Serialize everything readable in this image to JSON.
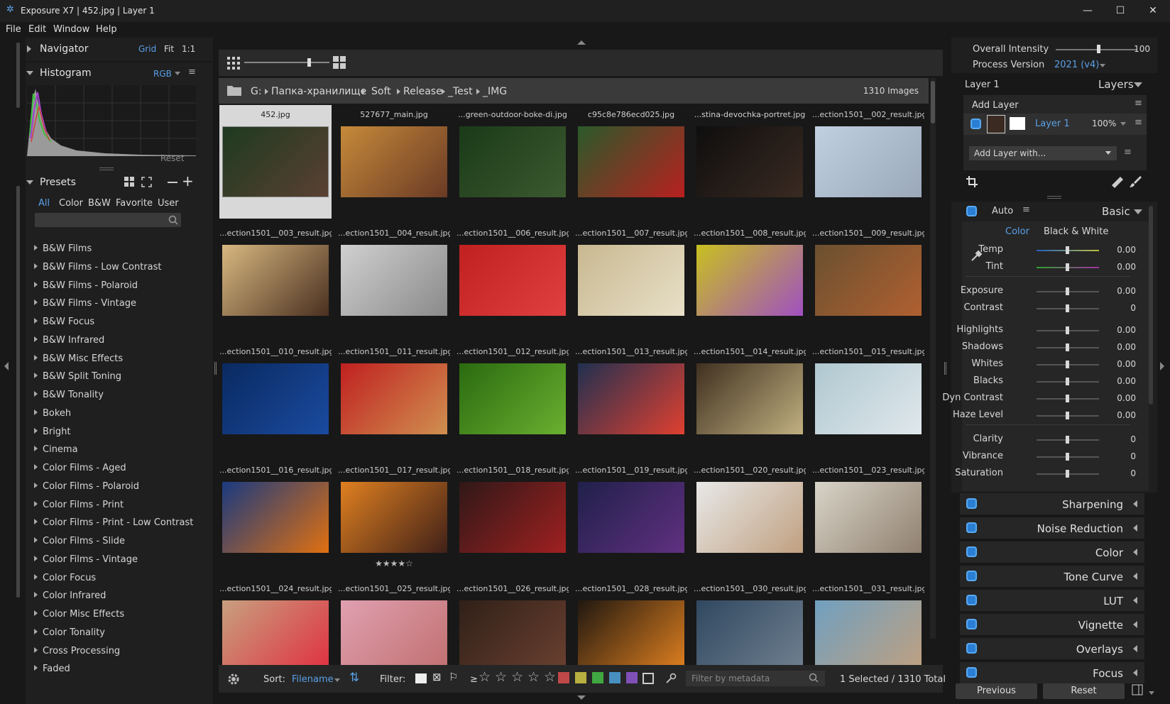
{
  "window": {
    "title": "Exposure X7 | 452.jpg | Layer 1",
    "app_icon": "exposure-logo-icon"
  },
  "menu": [
    "File",
    "Edit",
    "Window",
    "Help"
  ],
  "navigator": {
    "title": "Navigator",
    "options": [
      "Grid",
      "Fit",
      "1:1"
    ],
    "active": "Grid"
  },
  "histogram": {
    "title": "Histogram",
    "channel": "RGB",
    "reset": "Reset"
  },
  "presets": {
    "title": "Presets",
    "tabs": [
      "All",
      "Color",
      "B&W",
      "Favorite",
      "User"
    ],
    "active_tab": "All",
    "search_placeholder": "",
    "items": [
      "B&W Films",
      "B&W Films - Low Contrast",
      "B&W Films - Polaroid",
      "B&W Films - Vintage",
      "B&W Focus",
      "B&W Infrared",
      "B&W Misc Effects",
      "B&W Split Toning",
      "B&W Tonality",
      "Bokeh",
      "Bright",
      "Cinema",
      "Color Films - Aged",
      "Color Films - Polaroid",
      "Color Films - Print",
      "Color Films - Print - Low Contrast",
      "Color Films - Slide",
      "Color Films - Vintage",
      "Color Focus",
      "Color Infrared",
      "Color Misc Effects",
      "Color Tonality",
      "Cross Processing",
      "Faded"
    ]
  },
  "breadcrumb": {
    "drive": "G:",
    "path": [
      "Папка-хранилище",
      "Soft",
      "Release",
      "_Test",
      "_IMG"
    ],
    "count": "1310 Images"
  },
  "grid": {
    "selected_index": 0,
    "rated_index": 19,
    "rating": "★★★★☆",
    "captions": [
      "452.jpg",
      "527677_main.jpg",
      "...green-outdoor-boke-di.jpg",
      "c95c8e786ecd025.jpg",
      "...stina-devochka-portret.jpg",
      "...ection1501__002_result.jpg",
      "...ection1501__003_result.jpg",
      "...ection1501__004_result.jpg",
      "...ection1501__006_result.jpg",
      "...ection1501__007_result.jpg",
      "...ection1501__008_result.jpg",
      "...ection1501__009_result.jpg",
      "...ection1501__010_result.jpg",
      "...ection1501__011_result.jpg",
      "...ection1501__012_result.jpg",
      "...ection1501__013_result.jpg",
      "...ection1501__014_result.jpg",
      "...ection1501__015_result.jpg",
      "...ection1501__016_result.jpg",
      "...ection1501__017_result.jpg",
      "...ection1501__018_result.jpg",
      "...ection1501__019_result.jpg",
      "...ection1501__020_result.jpg",
      "...ection1501__023_result.jpg",
      "...ection1501__024_result.jpg",
      "...ection1501__025_result.jpg",
      "...ection1501__026_result.jpg",
      "...ection1501__028_result.jpg",
      "...ection1501__030_result.jpg",
      "...ection1501__031_result.jpg"
    ],
    "colors": [
      [
        "#1e3a20",
        "#5a4032"
      ],
      [
        "#c68a3a",
        "#6a3a25"
      ],
      [
        "#1a3a18",
        "#3c5a30"
      ],
      [
        "#2a5a2a",
        "#b82020"
      ],
      [
        "#0e0e0e",
        "#3a2a22"
      ],
      [
        "#c0d0e0",
        "#9aa8b8"
      ],
      [
        "#d8b880",
        "#4a3020"
      ],
      [
        "#d0d0d0",
        "#8a8a8a"
      ],
      [
        "#c02020",
        "#e04040"
      ],
      [
        "#c8b890",
        "#e8e0c8"
      ],
      [
        "#c8c020",
        "#a050c0"
      ],
      [
        "#6a5030",
        "#b06030"
      ],
      [
        "#0a2a60",
        "#1a4aa0"
      ],
      [
        "#c02020",
        "#d09050"
      ],
      [
        "#2a6a10",
        "#6ab030"
      ],
      [
        "#203050",
        "#e04030"
      ],
      [
        "#403020",
        "#c0b080"
      ],
      [
        "#b0c8d0",
        "#e0e8ec"
      ],
      [
        "#1a3a80",
        "#e07010"
      ],
      [
        "#e08020",
        "#402018"
      ],
      [
        "#301818",
        "#a02020"
      ],
      [
        "#20204a",
        "#603080"
      ],
      [
        "#e8e8e8",
        "#c0a080"
      ],
      [
        "#d8d4c8",
        "#908070"
      ],
      [
        "#c8a080",
        "#e03040"
      ],
      [
        "#e0a0b0",
        "#c07070"
      ],
      [
        "#302018",
        "#6a4030"
      ],
      [
        "#201810",
        "#e08020"
      ],
      [
        "#304860",
        "#708090"
      ],
      [
        "#70a0c0",
        "#c0a080"
      ]
    ]
  },
  "right": {
    "overall_intensity": {
      "label": "Overall Intensity",
      "value": "100",
      "level": 1.0
    },
    "process_version": {
      "label": "Process Version",
      "value": "2021 (v4)"
    },
    "layer_name": "Layer 1",
    "layers_label": "Layers",
    "add_layer": "Add Layer",
    "layer_row": {
      "name": "Layer 1",
      "opacity": "100%"
    },
    "add_layer_with": "Add Layer with...",
    "basic": {
      "auto": "Auto",
      "title": "Basic",
      "mode_color": "Color",
      "mode_bw": "Black & White",
      "sliders": [
        {
          "label": "Temp",
          "value": "0.00"
        },
        {
          "label": "Tint",
          "value": "0.00"
        },
        {
          "label": "Exposure",
          "value": "0.00"
        },
        {
          "label": "Contrast",
          "value": "0"
        },
        {
          "label": "Highlights",
          "value": "0.00"
        },
        {
          "label": "Shadows",
          "value": "0.00"
        },
        {
          "label": "Whites",
          "value": "0.00"
        },
        {
          "label": "Blacks",
          "value": "0.00"
        },
        {
          "label": "Dyn Contrast",
          "value": "0.00"
        },
        {
          "label": "Haze Level",
          "value": "0.00"
        },
        {
          "label": "Clarity",
          "value": "0"
        },
        {
          "label": "Vibrance",
          "value": "0"
        },
        {
          "label": "Saturation",
          "value": "0"
        }
      ]
    },
    "sections": [
      "Sharpening",
      "Noise Reduction",
      "Color",
      "Tone Curve",
      "LUT",
      "Vignette",
      "Overlays",
      "Focus"
    ],
    "previous": "Previous",
    "reset": "Reset"
  },
  "footer": {
    "sort_label": "Sort:",
    "sort_value": "Filename",
    "filter_label": "Filter:",
    "rating_op": "≥",
    "metadata_placeholder": "Filter by metadata",
    "status": "1 Selected / 1310 Total",
    "swatches": [
      "#c04848",
      "#b8b040",
      "#40a840",
      "#4890c0",
      "#8050b8"
    ]
  }
}
